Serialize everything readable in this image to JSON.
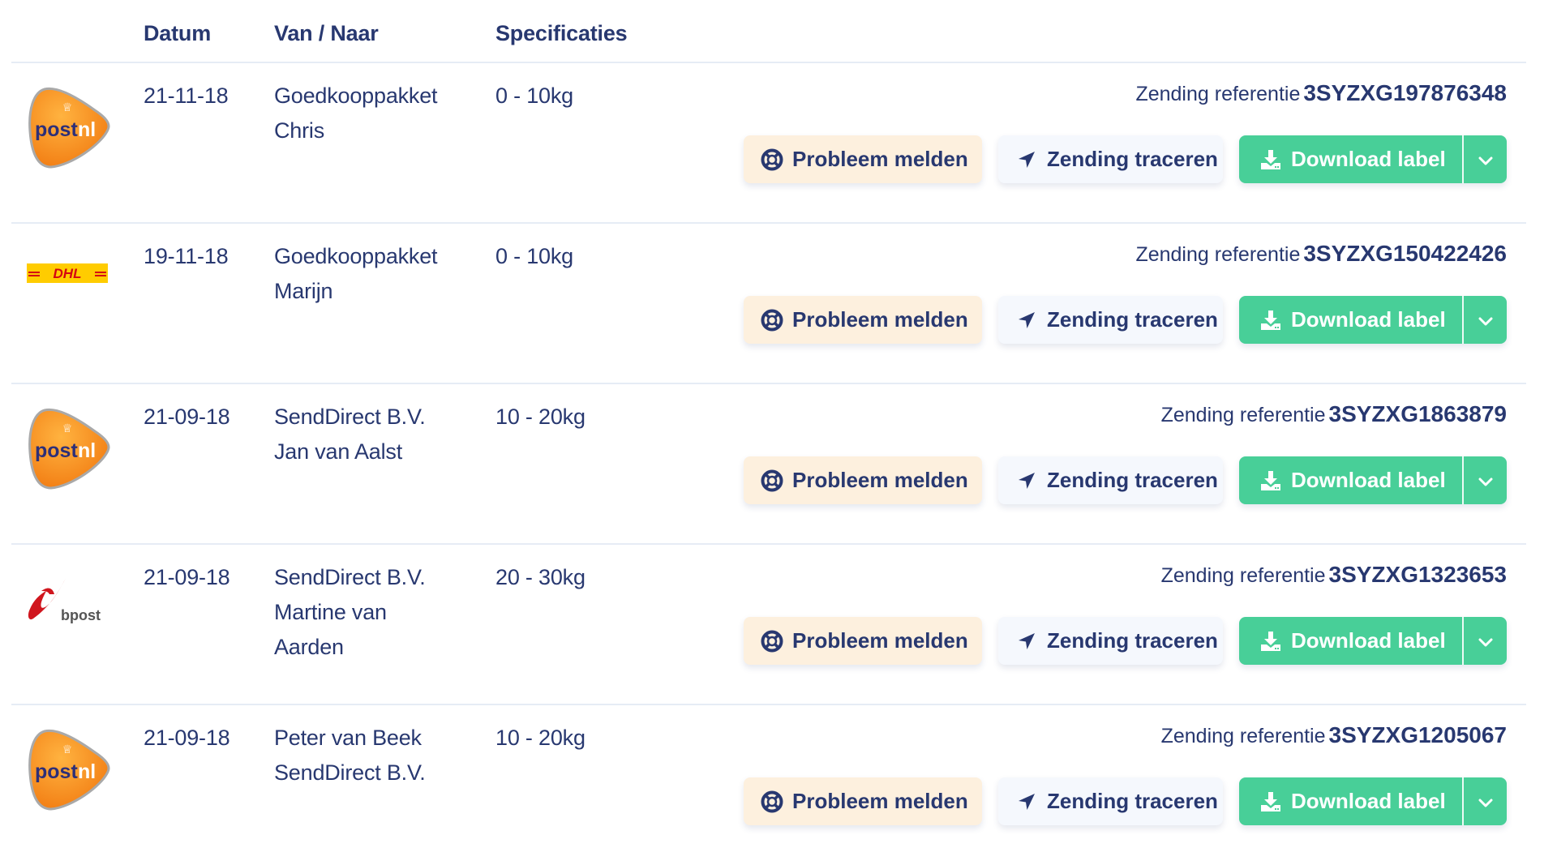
{
  "table": {
    "columns": {
      "logo": "",
      "date": "Datum",
      "from_to": "Van / Naar",
      "specs": "Specificaties"
    },
    "reference_label": "Zending referentie",
    "actions": {
      "report_problem": "Probleem melden",
      "track": "Zending traceren",
      "download": "Download label"
    },
    "colors": {
      "text": "#283870",
      "download_green": "#48cf98",
      "problem_bg": "#fdf0de",
      "track_bg": "#f5f8fd",
      "divider": "#e6ecf5"
    },
    "rows": [
      {
        "carrier": "postnl",
        "date": "21-11-18",
        "from_to": [
          "Goedkooppakket",
          "Chris"
        ],
        "specs": "0 - 10kg",
        "reference": "3SYZXG197876348"
      },
      {
        "carrier": "dhl",
        "date": "19-11-18",
        "from_to": [
          "Goedkooppakket",
          "Marijn"
        ],
        "specs": "0 - 10kg",
        "reference": "3SYZXG150422426"
      },
      {
        "carrier": "postnl",
        "date": "21-09-18",
        "from_to": [
          "SendDirect B.V.",
          "Jan van Aalst"
        ],
        "specs": "10 - 20kg",
        "reference": "3SYZXG1863879"
      },
      {
        "carrier": "bpost",
        "date": "21-09-18",
        "from_to": [
          "SendDirect B.V.",
          "Martine van",
          "Aarden"
        ],
        "specs": "20 - 30kg",
        "reference": "3SYZXG1323653"
      },
      {
        "carrier": "postnl",
        "date": "21-09-18",
        "from_to": [
          "Peter van Beek",
          "SendDirect B.V."
        ],
        "specs": "10 - 20kg",
        "reference": "3SYZXG1205067"
      }
    ]
  }
}
